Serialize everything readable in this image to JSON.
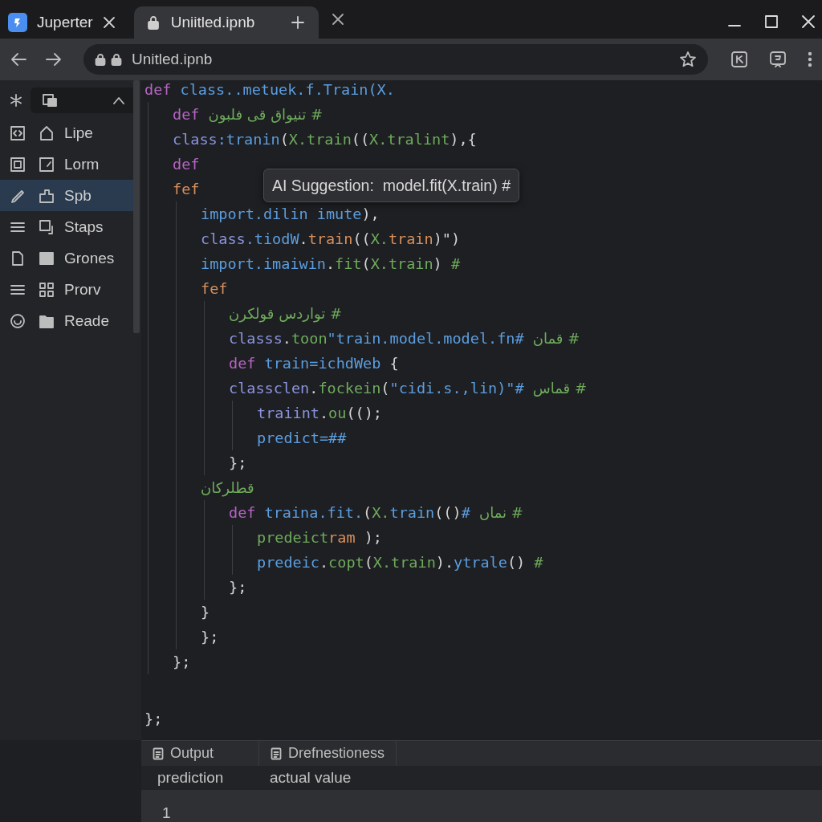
{
  "tabs": [
    {
      "title": "Juperter",
      "selected": false
    },
    {
      "title": "Uniitled.ipnb",
      "selected": true
    }
  ],
  "address_bar": {
    "url": "Unitled.ipnb"
  },
  "sidebar": {
    "items": [
      {
        "label": "Lipe",
        "selected": false
      },
      {
        "label": "Lorm",
        "selected": false
      },
      {
        "label": "Spb",
        "selected": true
      },
      {
        "label": "Staps",
        "selected": false
      },
      {
        "label": "Grones",
        "selected": false
      },
      {
        "label": "Prorv",
        "selected": false
      },
      {
        "label": "Reade",
        "selected": false
      }
    ]
  },
  "editor": {
    "lines": [
      {
        "tokens": [
          {
            "kind": "keyword",
            "text": "def "
          },
          {
            "kind": "name",
            "text": "class..metuek.f.Train(X."
          }
        ],
        "children": [
          {
            "tokens": [
              {
                "kind": "keyword",
                "text": "def "
              },
              {
                "kind": "comment",
                "text": "# تنيواق قى فلبون"
              }
            ]
          },
          {
            "tokens": [
              {
                "kind": "class",
                "text": "class"
              },
              {
                "kind": "name",
                "text": ":tranin"
              },
              {
                "kind": "punct",
                "text": "("
              },
              {
                "kind": "string",
                "text": "X.train"
              },
              {
                "kind": "punct",
                "text": "(("
              },
              {
                "kind": "string",
                "text": "X.tralint"
              },
              {
                "kind": "punct",
                "text": "),{"
              }
            ]
          },
          {
            "tokens": [
              {
                "kind": "keyword",
                "text": "def"
              }
            ]
          },
          {
            "tokens": [
              {
                "kind": "number",
                "text": "fef"
              }
            ],
            "children": [
              {
                "tokens": [
                  {
                    "kind": "name",
                    "text": "import.dilin imute"
                  },
                  {
                    "kind": "punct",
                    "text": "),"
                  }
                ]
              },
              {
                "tokens": [
                  {
                    "kind": "class",
                    "text": "class"
                  },
                  {
                    "kind": "name",
                    "text": ".tiodW"
                  },
                  {
                    "kind": "punct",
                    "text": "."
                  },
                  {
                    "kind": "number",
                    "text": "train"
                  },
                  {
                    "kind": "punct",
                    "text": "(("
                  },
                  {
                    "kind": "string",
                    "text": "X."
                  },
                  {
                    "kind": "number",
                    "text": "train"
                  },
                  {
                    "kind": "punct",
                    "text": ")\")"
                  }
                ]
              },
              {
                "tokens": [
                  {
                    "kind": "name",
                    "text": "import.imaiwin"
                  },
                  {
                    "kind": "punct",
                    "text": "."
                  },
                  {
                    "kind": "string",
                    "text": "fit"
                  },
                  {
                    "kind": "punct",
                    "text": "("
                  },
                  {
                    "kind": "string",
                    "text": "X.train"
                  },
                  {
                    "kind": "punct",
                    "text": ") "
                  },
                  {
                    "kind": "string",
                    "text": "#"
                  }
                ]
              },
              {
                "tokens": [
                  {
                    "kind": "number",
                    "text": "fef"
                  }
                ],
                "children": [
                  {
                    "tokens": [
                      {
                        "kind": "comment",
                        "text": "# تواردس قولكرن"
                      }
                    ]
                  },
                  {
                    "tokens": [
                      {
                        "kind": "class",
                        "text": "classs"
                      },
                      {
                        "kind": "punct",
                        "text": "."
                      },
                      {
                        "kind": "string",
                        "text": "toon"
                      },
                      {
                        "kind": "name",
                        "text": "\"train.model.model.fn# "
                      },
                      {
                        "kind": "comment",
                        "text": "# قمان"
                      }
                    ]
                  },
                  {
                    "tokens": [
                      {
                        "kind": "keyword",
                        "text": "def "
                      },
                      {
                        "kind": "name",
                        "text": "train=ichdWeb"
                      },
                      {
                        "kind": "punct",
                        "text": " {"
                      }
                    ]
                  },
                  {
                    "tokens": [
                      {
                        "kind": "class",
                        "text": "classclen"
                      },
                      {
                        "kind": "punct",
                        "text": "."
                      },
                      {
                        "kind": "string",
                        "text": "fockein"
                      },
                      {
                        "kind": "punct",
                        "text": "("
                      },
                      {
                        "kind": "name",
                        "text": "\"cidi.s.,lin)\"# "
                      },
                      {
                        "kind": "comment",
                        "text": "# قماس"
                      }
                    ],
                    "children": [
                      {
                        "tokens": [
                          {
                            "kind": "class",
                            "text": "traiint"
                          },
                          {
                            "kind": "punct",
                            "text": "."
                          },
                          {
                            "kind": "string",
                            "text": "ou"
                          },
                          {
                            "kind": "punct",
                            "text": "(();"
                          }
                        ]
                      },
                      {
                        "tokens": [
                          {
                            "kind": "name",
                            "text": "predict=##"
                          }
                        ]
                      }
                    ]
                  },
                  {
                    "tokens": [
                      {
                        "kind": "punct",
                        "text": "};"
                      }
                    ]
                  }
                ]
              },
              {
                "tokens": [
                  {
                    "kind": "comment",
                    "text": "قطلركان"
                  }
                ],
                "children": [
                  {
                    "tokens": [
                      {
                        "kind": "keyword",
                        "text": "def "
                      },
                      {
                        "kind": "name",
                        "text": "traina.fit."
                      },
                      {
                        "kind": "punct",
                        "text": "("
                      },
                      {
                        "kind": "string",
                        "text": "X."
                      },
                      {
                        "kind": "name",
                        "text": "train"
                      },
                      {
                        "kind": "punct",
                        "text": "(()"
                      },
                      {
                        "kind": "name",
                        "text": "# "
                      },
                      {
                        "kind": "comment",
                        "text": "# نماں"
                      }
                    ],
                    "children": [
                      {
                        "tokens": [
                          {
                            "kind": "string",
                            "text": "predeict"
                          },
                          {
                            "kind": "number",
                            "text": "ram"
                          },
                          {
                            "kind": "punct",
                            "text": " );"
                          }
                        ]
                      },
                      {
                        "tokens": [
                          {
                            "kind": "name",
                            "text": "predeic"
                          },
                          {
                            "kind": "punct",
                            "text": "."
                          },
                          {
                            "kind": "string",
                            "text": "copt"
                          },
                          {
                            "kind": "punct",
                            "text": "("
                          },
                          {
                            "kind": "string",
                            "text": "X.train"
                          },
                          {
                            "kind": "punct",
                            "text": ")."
                          },
                          {
                            "kind": "name",
                            "text": "ytrale"
                          },
                          {
                            "kind": "punct",
                            "text": "() "
                          },
                          {
                            "kind": "string",
                            "text": "#"
                          }
                        ]
                      }
                    ]
                  },
                  {
                    "tokens": [
                      {
                        "kind": "punct",
                        "text": "};"
                      }
                    ]
                  }
                ]
              },
              {
                "tokens": [
                  {
                    "kind": "punct",
                    "text": "}"
                  }
                ]
              },
              {
                "tokens": [
                  {
                    "kind": "punct",
                    "text": "};"
                  }
                ]
              }
            ]
          },
          {
            "tokens": [
              {
                "kind": "punct",
                "text": "};"
              }
            ]
          }
        ]
      },
      {
        "tokens": [
          {
            "kind": "punct",
            "text": "};"
          }
        ]
      }
    ],
    "tooltip": "AI Suggestion:  model.fit(X.train) #"
  },
  "output": {
    "tabs": [
      "Output",
      "Drefnestioness"
    ],
    "columns": [
      "prediction",
      "actual value"
    ],
    "rows": [
      [
        "1"
      ]
    ]
  }
}
